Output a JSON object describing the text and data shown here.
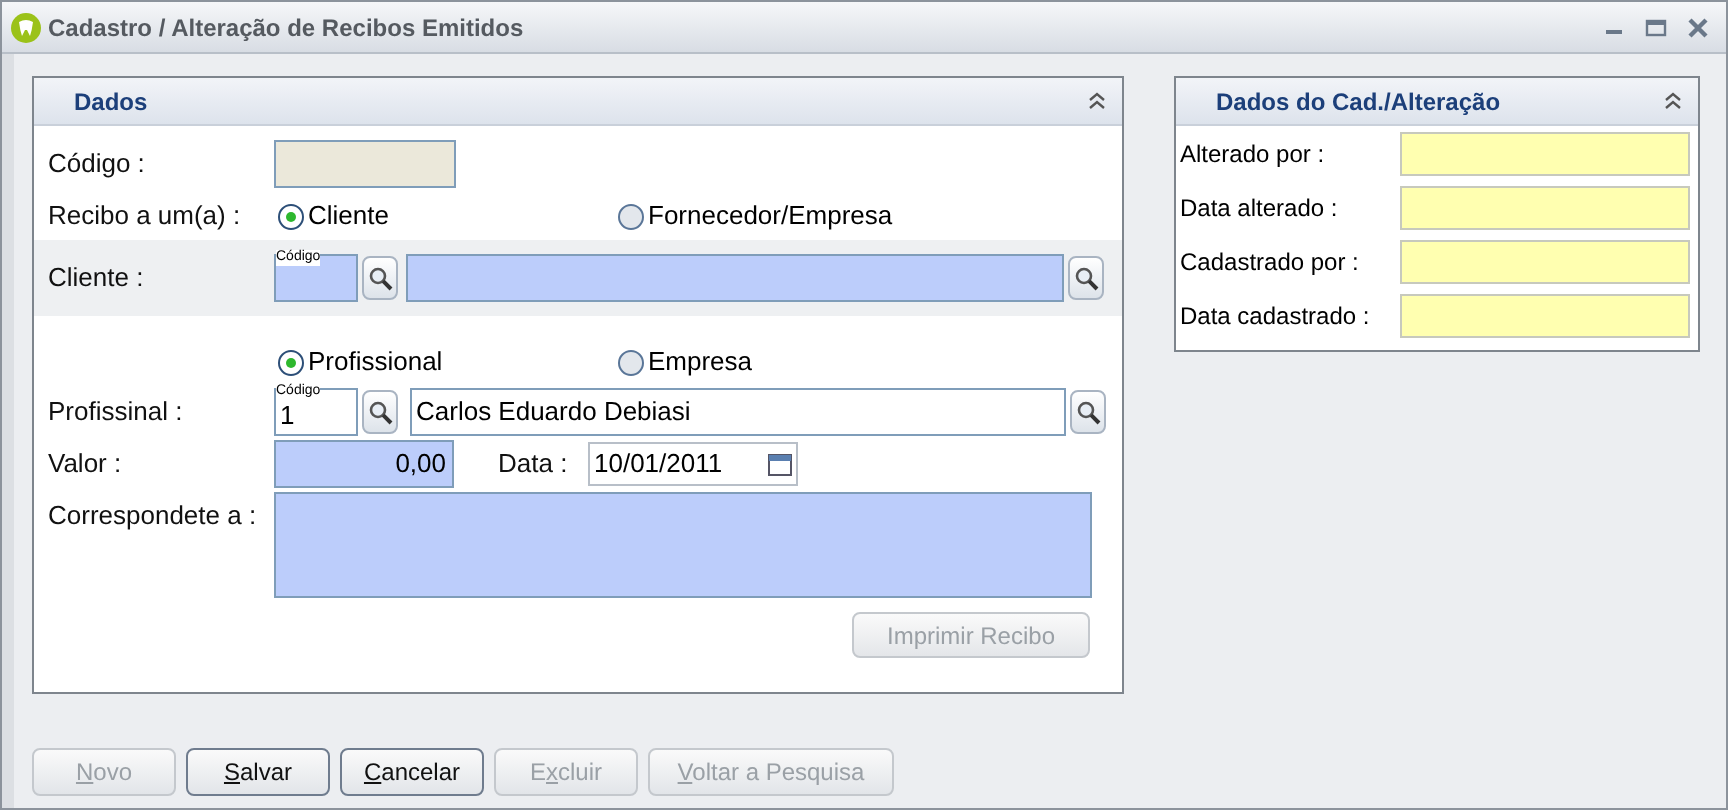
{
  "window": {
    "title": "Cadastro / Alteração de Recibos Emitidos"
  },
  "dados": {
    "title": "Dados",
    "codigo": {
      "label": "Código :"
    },
    "recibo": {
      "label": "Recibo a um(a) :",
      "options": [
        {
          "label": "Cliente",
          "selected": true
        },
        {
          "label": "Fornecedor/Empresa",
          "selected": false
        }
      ]
    },
    "cliente": {
      "label": "Cliente :",
      "code_caption": "Código"
    },
    "tipo": {
      "options": [
        {
          "label": "Profissional",
          "selected": true
        },
        {
          "label": "Empresa",
          "selected": false
        }
      ]
    },
    "profissional": {
      "label": "Profissinal :",
      "code_caption": "Código",
      "code": "1",
      "name": "Carlos Eduardo Debiasi"
    },
    "valor": {
      "label": "Valor :",
      "value": "0,00"
    },
    "data": {
      "label": "Data :",
      "value": "10/01/2011"
    },
    "correspondente": {
      "label": "Correspondete a :"
    },
    "print_button": {
      "label": "Imprimir Recibo",
      "disabled": true
    }
  },
  "audit": {
    "title": "Dados do Cad./Alteração",
    "fields": [
      {
        "label": "Alterado por :"
      },
      {
        "label": "Data alterado :"
      },
      {
        "label": "Cadastrado por :"
      },
      {
        "label": "Data cadastrado :"
      }
    ]
  },
  "buttons": [
    {
      "key": "N",
      "rest": "ovo",
      "disabled": true
    },
    {
      "key": "S",
      "rest": "alvar",
      "disabled": false
    },
    {
      "key": "C",
      "rest": "ancelar",
      "disabled": false
    },
    {
      "pre": "E",
      "key": "x",
      "rest": "cluir",
      "disabled": true
    },
    {
      "key": "V",
      "rest": "oltar a Pesquisa",
      "disabled": true
    }
  ]
}
